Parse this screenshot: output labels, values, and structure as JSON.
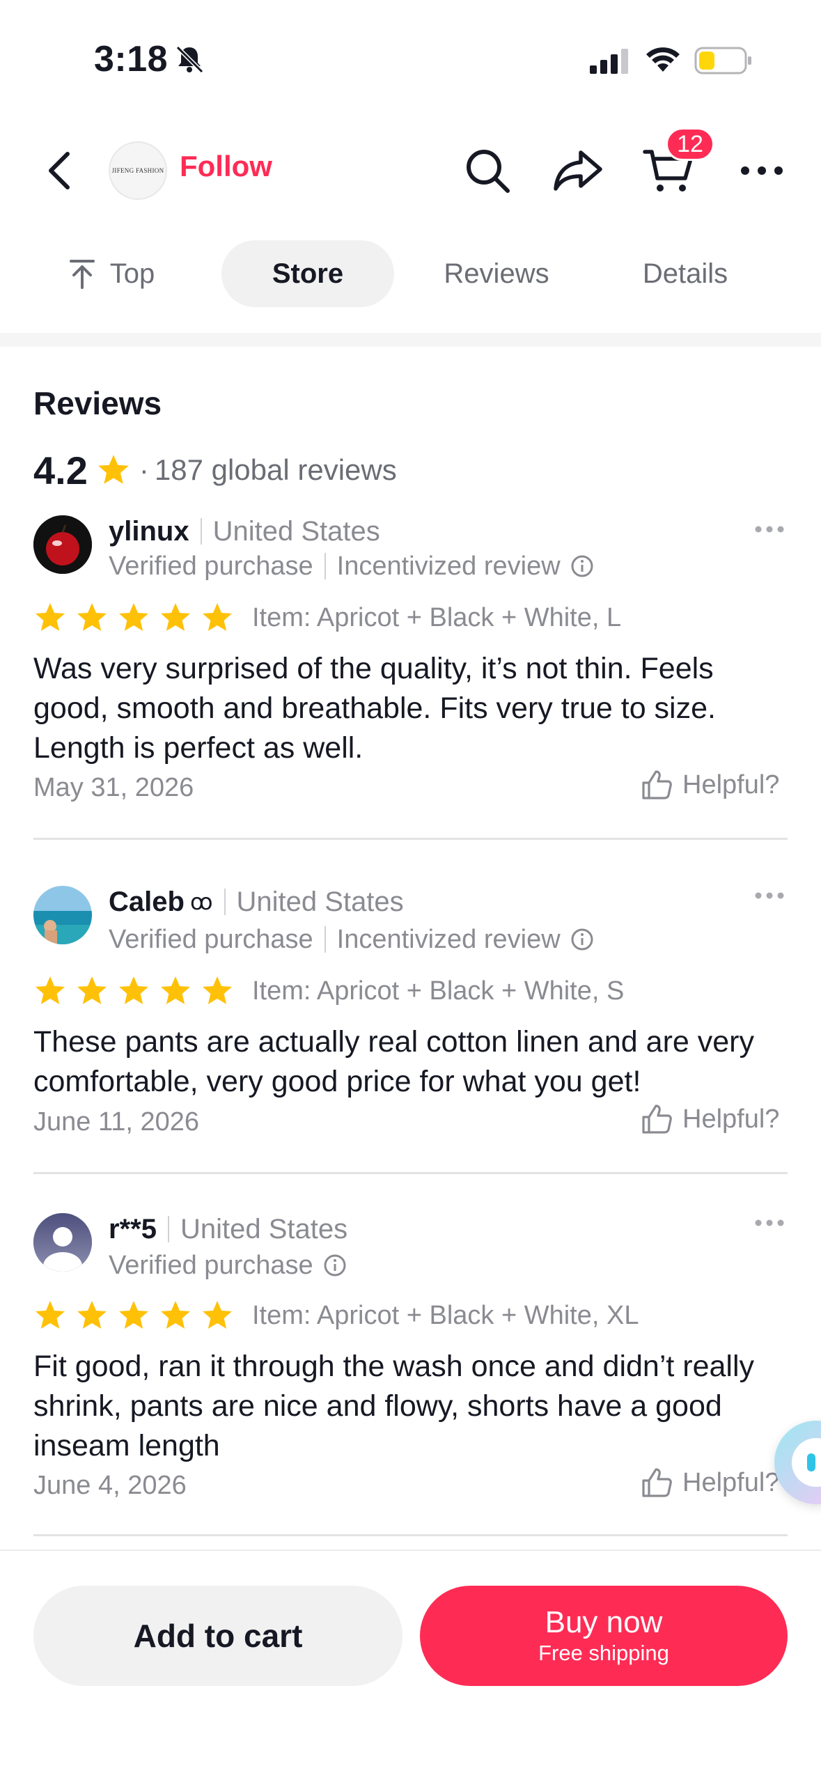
{
  "status_bar": {
    "time": "3:18",
    "icons": [
      "bell-slash-icon",
      "signal-icon",
      "wifi-icon",
      "battery-icon"
    ],
    "battery_level": 0.35,
    "battery_color": "#ffd60a"
  },
  "header": {
    "store_logo_text": "JIFENG FASHION",
    "follow_label": "Follow",
    "cart_count": "12",
    "icons": [
      "back-icon",
      "search-icon",
      "share-icon",
      "cart-icon",
      "more-icon"
    ]
  },
  "tabs": [
    {
      "label": "Top",
      "active": false
    },
    {
      "label": "Store",
      "active": true
    },
    {
      "label": "Reviews",
      "active": false
    },
    {
      "label": "Details",
      "active": false
    }
  ],
  "reviews_section": {
    "title": "Reviews",
    "rating": "4.2",
    "separator": "·",
    "count_text": "187 global reviews"
  },
  "reviews": [
    {
      "name": "ylinux",
      "country": "United States",
      "verified": "Verified purchase",
      "incentivized": "Incentivized review",
      "stars": 5,
      "item": "Item: Apricot + Black + White, L",
      "body": "Was very surprised of the quality, it’s not thin. Feels good, smooth and breathable. Fits very true to size. Length is perfect as well.",
      "date": "May 31, 2026",
      "helpful": "Helpful?"
    },
    {
      "name": "Caleb",
      "name_suffix": "ꝏ",
      "country": "United States",
      "verified": "Verified purchase",
      "incentivized": "Incentivized review",
      "stars": 5,
      "item": "Item: Apricot + Black + White, S",
      "body": "These pants are actually real cotton linen and are very comfortable, very good price for what you get!",
      "date": "June 11, 2026",
      "helpful": "Helpful?"
    },
    {
      "name": "r**5",
      "country": "United States",
      "verified": "Verified purchase",
      "stars": 5,
      "item": "Item: Apricot + Black + White, XL",
      "body": "Fit good, ran it through the wash once and didn’t really shrink, pants are nice and flowy, shorts have a good inseam length",
      "date": "June 4, 2026",
      "helpful": "Helpful?"
    }
  ],
  "bottom_bar": {
    "add_to_cart": "Add to cart",
    "buy_now": "Buy now",
    "buy_now_sub": "Free shipping"
  },
  "colors": {
    "accent": "#fe2c55",
    "star": "#ffc107",
    "muted_text": "#8a8b91"
  }
}
